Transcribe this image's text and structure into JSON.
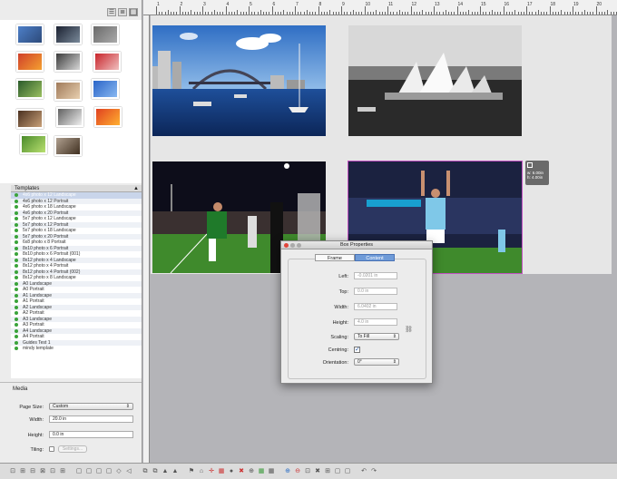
{
  "view_toggle": [
    "☰",
    "≣",
    "▦"
  ],
  "thumbnails": [
    {
      "colors": [
        "#4d7fc8",
        "#2d4a7a"
      ]
    },
    {
      "colors": [
        "#1a2030",
        "#7a8a9a"
      ]
    },
    {
      "colors": [
        "#6a6a6a",
        "#aaaaaa"
      ]
    },
    {
      "colors": [
        "#d0402a",
        "#f4a030"
      ]
    },
    {
      "colors": [
        "#3a3a3a",
        "#d8d8d8"
      ]
    },
    {
      "colors": [
        "#c8242a",
        "#f0c0c0"
      ]
    },
    {
      "colors": [
        "#2a5a2a",
        "#9ac060"
      ]
    },
    {
      "colors": [
        "#a07a5a",
        "#e8d0b0"
      ]
    },
    {
      "colors": [
        "#2a64c8",
        "#88b8f0"
      ]
    },
    {
      "colors": [
        "#4a3020",
        "#c8a078"
      ]
    },
    {
      "colors": [
        "#606060",
        "#f0f0f0"
      ]
    },
    {
      "colors": [
        "#e04020",
        "#ffb030"
      ]
    },
    {
      "colors": [
        "#4a8a2a",
        "#b8e070"
      ]
    },
    {
      "colors": [
        "#b0a090",
        "#403020"
      ]
    }
  ],
  "templates": {
    "header": "Templates",
    "caret": "▲",
    "items": [
      "4x6 photo x 12 Landscape",
      "4x6 photo x 12 Portrait",
      "4x6 photo x 18 Landscape",
      "4x6 photo x 20 Portrait",
      "5x7 photo x 12 Landscape",
      "5x7 photo x 12 Portrait",
      "5x7 photo x 18 Landscape",
      "5x7 photo x 20 Portrait",
      "6x8 photo x 8 Portrait",
      "8x10 photo x 6 Portrait",
      "8x10 photo x 6 Portrait (001)",
      "8x12 photo x 4 Landscape",
      "8x12 photo x 4 Portrait",
      "8x12 photo x 4 Portrait (002)",
      "8x12 photo x 8 Landscape",
      "A0 Landscape",
      "A0 Portrait",
      "A1 Landscape",
      "A1 Portrait",
      "A2 Landscape",
      "A2 Portrait",
      "A3 Landscape",
      "A3 Portrait",
      "A4 Landscape",
      "A4 Portrait",
      "Guides Test 1",
      "mindy template"
    ]
  },
  "media": {
    "title": "Media",
    "page_size_label": "Page Size:",
    "page_size_value": "Custom",
    "width_label": "Width:",
    "width_value": "20.0 in",
    "height_label": "Height:",
    "height_value": "0.0 in",
    "tiling_label": "Tiling:",
    "settings_button": "Settings..."
  },
  "ruler": {
    "numbers": [
      "1",
      "2",
      "3",
      "4",
      "5",
      "6",
      "7",
      "8",
      "9",
      "10",
      "11",
      "12",
      "13",
      "14",
      "15",
      "16",
      "17",
      "18",
      "19",
      "20"
    ]
  },
  "info_tag": {
    "w": "w: 6.00in",
    "h": "h: 4.00in"
  },
  "dialog": {
    "title": "Box Properties",
    "tabs": [
      "Frame",
      "Content"
    ],
    "active_tab": 1,
    "left_label": "Left:",
    "left_value": "-0.0201 in",
    "top_label": "Top:",
    "top_value": "0.0 in",
    "width_label": "Width:",
    "width_value": "6.0402 in",
    "height_label": "Height:",
    "height_value": "4.0 in",
    "scaling_label": "Scaling:",
    "scaling_value": "To Fill",
    "centring_label": "Centring:",
    "centring_checked": true,
    "orientation_label": "Orientation:",
    "orientation_value": "0°"
  },
  "toolbar": {
    "icons": [
      "⊡",
      "⊞",
      "⊟",
      "⊠",
      "⊡",
      "⊞",
      "▢",
      "▢",
      "▢",
      "▢",
      "◇",
      "◁",
      "⧉",
      "⧉",
      "▲",
      "▲",
      "⚑",
      "⌂",
      "✛",
      "▦",
      "●",
      "✖",
      "⊕",
      "▦",
      "▦",
      "⊕",
      "⊖",
      "⊡",
      "✖",
      "⊞",
      "▢",
      "▢",
      "↶",
      "↷"
    ]
  }
}
